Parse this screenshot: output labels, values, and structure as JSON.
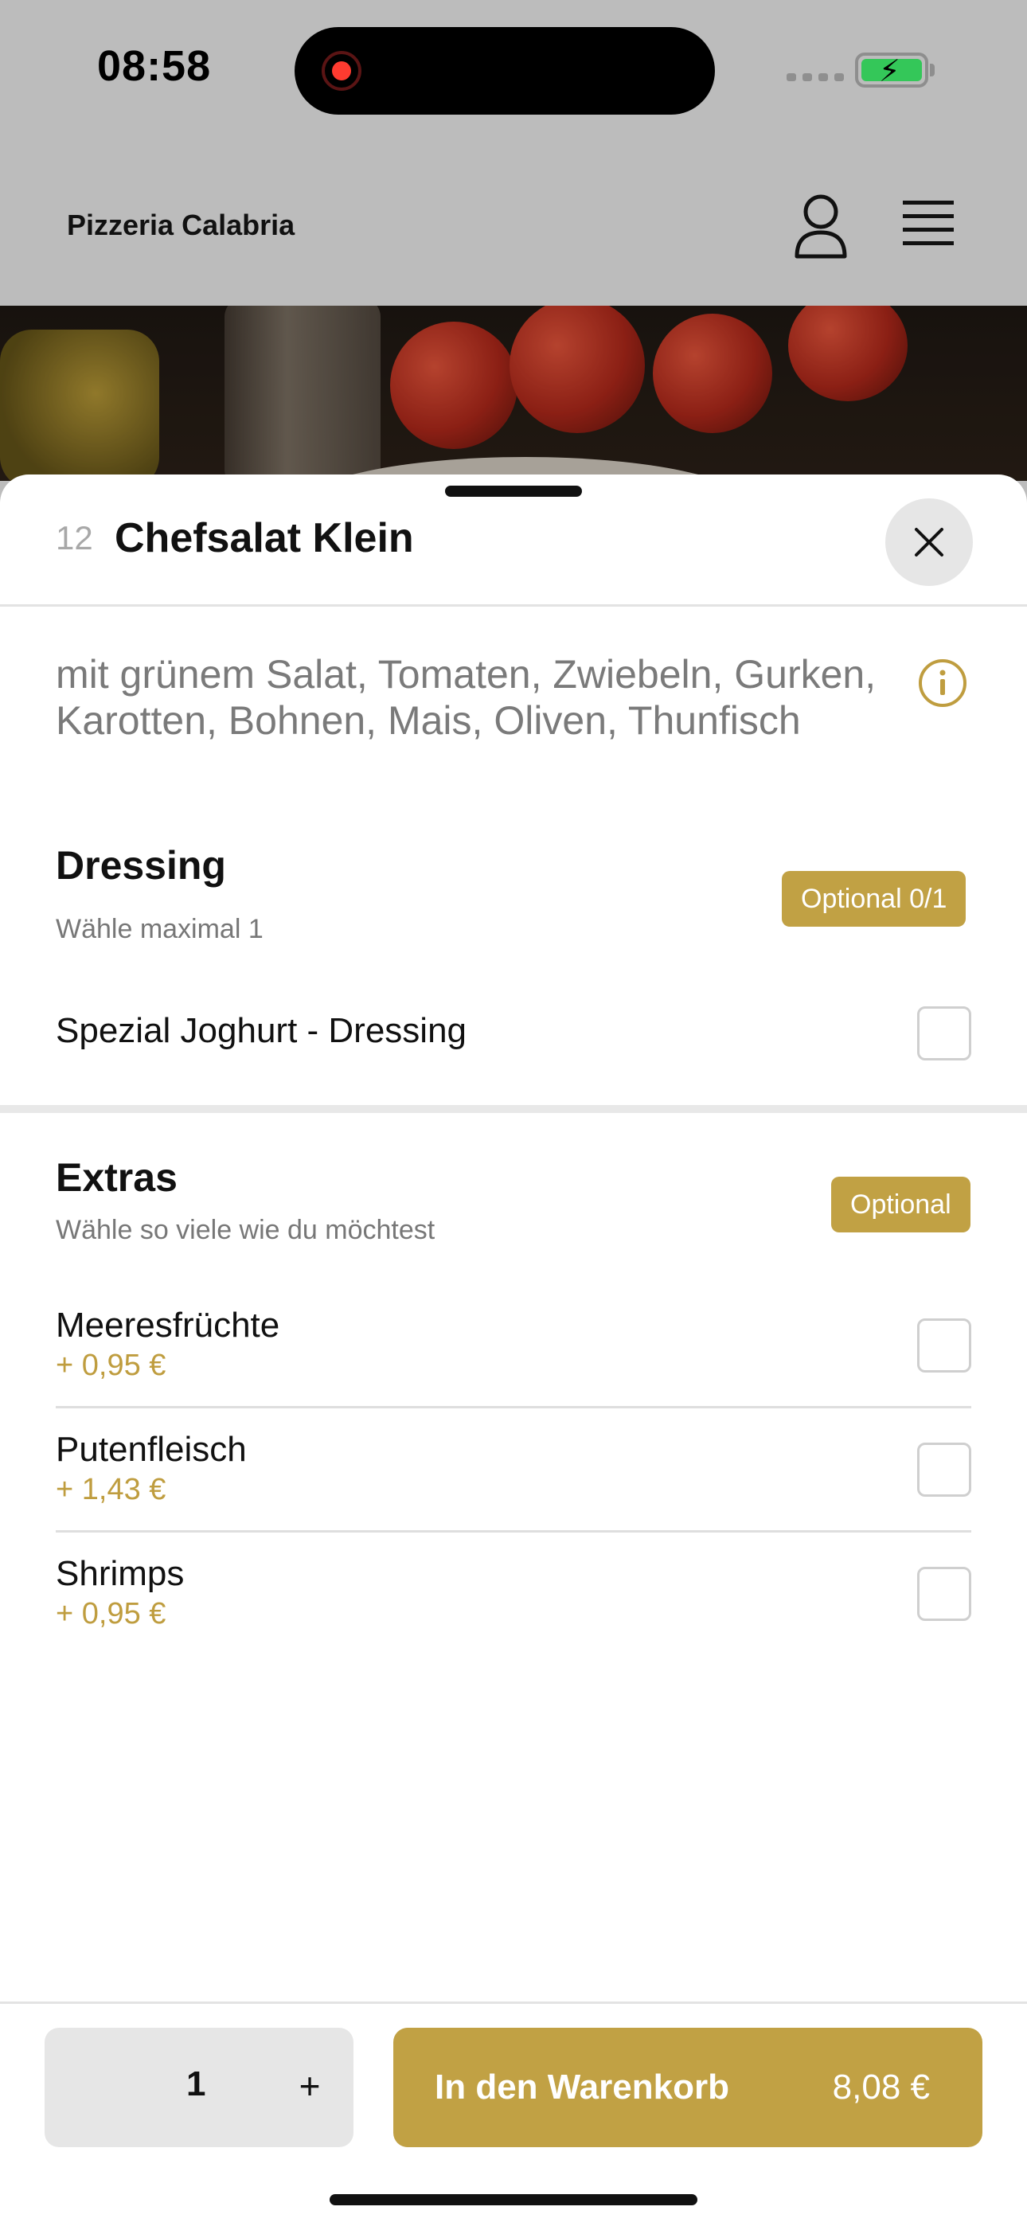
{
  "status_bar": {
    "time": "08:58"
  },
  "header": {
    "brand": "Pizzeria Calabria"
  },
  "item": {
    "number": "12",
    "title": "Chefsalat Klein",
    "description": "mit grünem Salat, Tomaten, Zwiebeln, Gurken, Karotten, Bohnen, Mais, Oliven, Thunfisch"
  },
  "dressing": {
    "title": "Dressing",
    "subtitle": "Wähle maximal 1",
    "badge": "Optional 0/1",
    "options": [
      {
        "label": "Spezial Joghurt - Dressing"
      }
    ]
  },
  "extras": {
    "title": "Extras",
    "subtitle": "Wähle so viele wie du möchtest",
    "badge": "Optional",
    "options": [
      {
        "label": "Meeresfrüchte",
        "price": "+ 0,95 €"
      },
      {
        "label": "Putenfleisch",
        "price": "+ 1,43 €"
      },
      {
        "label": "Shrimps",
        "price": "+ 0,95 €"
      }
    ]
  },
  "footer": {
    "quantity": "1",
    "plus": "+",
    "cart_label": "In den Warenkorb",
    "cart_price": "8,08 €"
  },
  "colors": {
    "accent": "#c1a144",
    "price": "#bf9d3f"
  }
}
